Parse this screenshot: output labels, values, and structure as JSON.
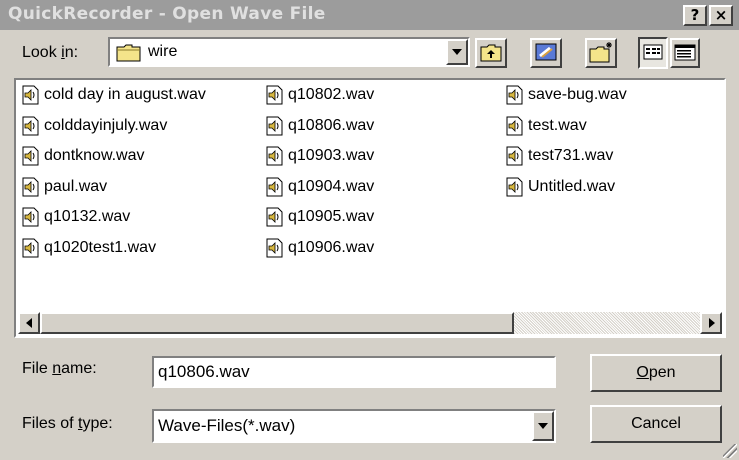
{
  "window": {
    "title": "QuickRecorder - Open Wave File",
    "help_label": "?",
    "close_label": "×"
  },
  "look_in": {
    "label_pre": "Look ",
    "label_accel": "i",
    "label_post": "n:",
    "value": "wire",
    "folder_icon": "folder-icon"
  },
  "toolbar": {
    "up_icon": "up-one-level-icon",
    "desktop_icon": "desktop-icon",
    "new_folder_icon": "new-folder-icon",
    "list_icon": "list-view-icon",
    "details_icon": "details-view-icon"
  },
  "files": {
    "col1": [
      "cold day in august.wav",
      "colddayinjuly.wav",
      "dontknow.wav",
      "paul.wav",
      "q10132.wav",
      "q1020test1.wav"
    ],
    "col2": [
      "q10802.wav",
      "q10806.wav",
      "q10903.wav",
      "q10904.wav",
      "q10905.wav",
      "q10906.wav"
    ],
    "col3": [
      "save-bug.wav",
      "test.wav",
      "test731.wav",
      "Untitled.wav"
    ]
  },
  "file_name": {
    "label_pre": "File ",
    "label_accel": "n",
    "label_post": "ame:",
    "value": "q10806.wav"
  },
  "file_type": {
    "label_pre": "Files of ",
    "label_accel": "t",
    "label_post": "ype:",
    "value": "Wave-Files(*.wav)"
  },
  "buttons": {
    "open_accel": "O",
    "open_rest": "pen",
    "cancel": "Cancel"
  },
  "colors": {
    "face": "#d4d0c8",
    "titlebar": "#9c9c9c",
    "title_text": "#e0e0e0"
  }
}
